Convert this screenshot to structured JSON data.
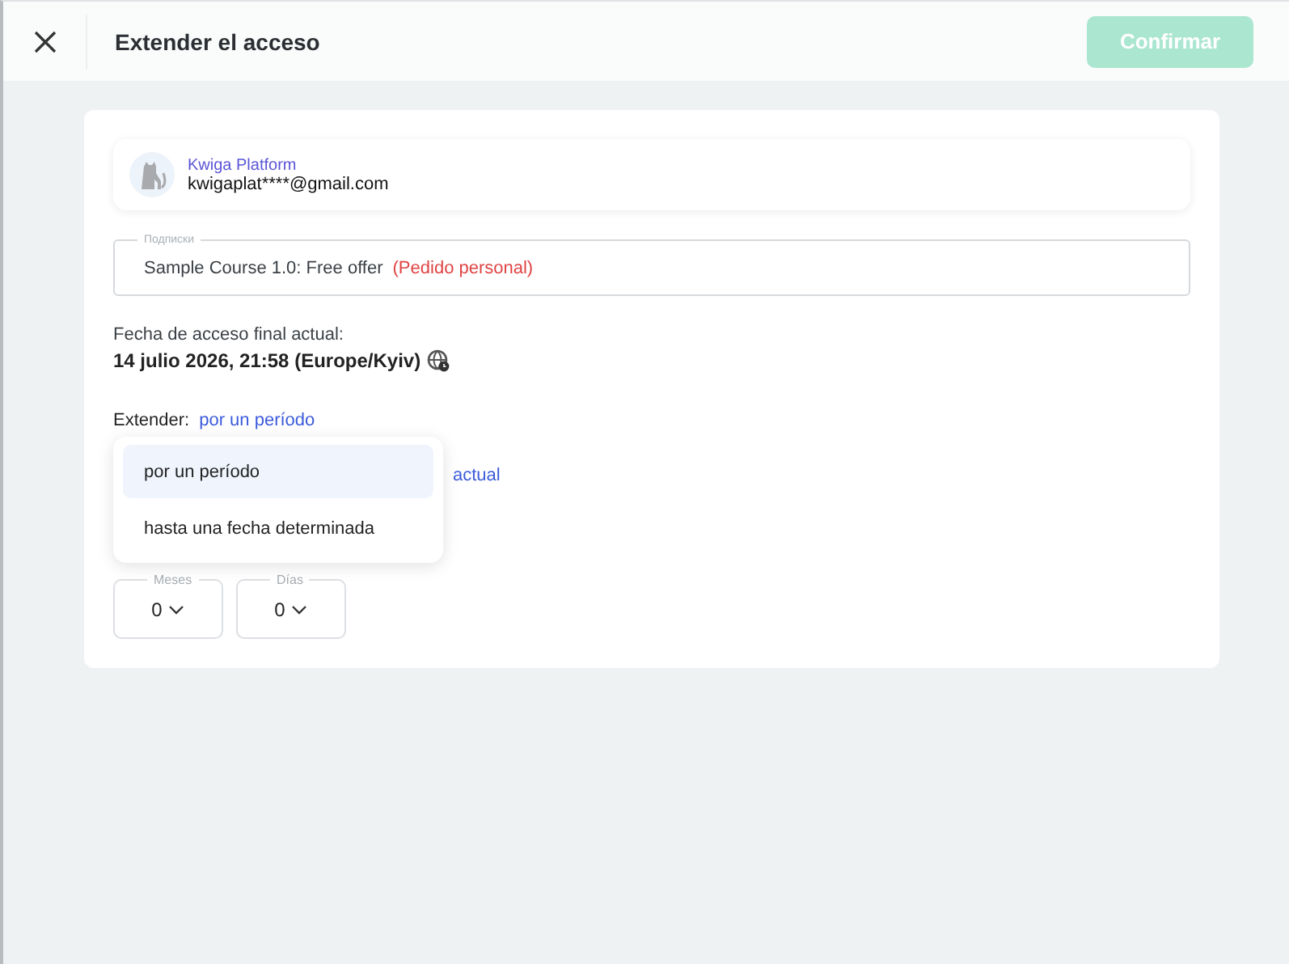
{
  "header": {
    "title": "Extender el acceso",
    "confirm_button": {
      "label": "Confirmar",
      "disabled": true
    }
  },
  "user": {
    "name": "Kwiga Platform",
    "email": "kwigaplat****@gmail.com"
  },
  "subscription_field": {
    "label": "Подписки",
    "value": "Sample Course 1.0: Free offer",
    "tag": "(Pedido personal)"
  },
  "current_end": {
    "label": "Fecha de acceso final actual:",
    "value": "14 julio 2026, 21:58 (Europe/Kyiv)"
  },
  "extend": {
    "label": "Extender:",
    "mode": "por un período",
    "partial_link": "actual"
  },
  "menu": [
    {
      "label": "por un período",
      "selected": true
    },
    {
      "label": "hasta una fecha determinada",
      "selected": false
    }
  ],
  "selects": [
    {
      "label": "Meses",
      "value": "0"
    },
    {
      "label": "Días",
      "value": "0"
    }
  ]
}
